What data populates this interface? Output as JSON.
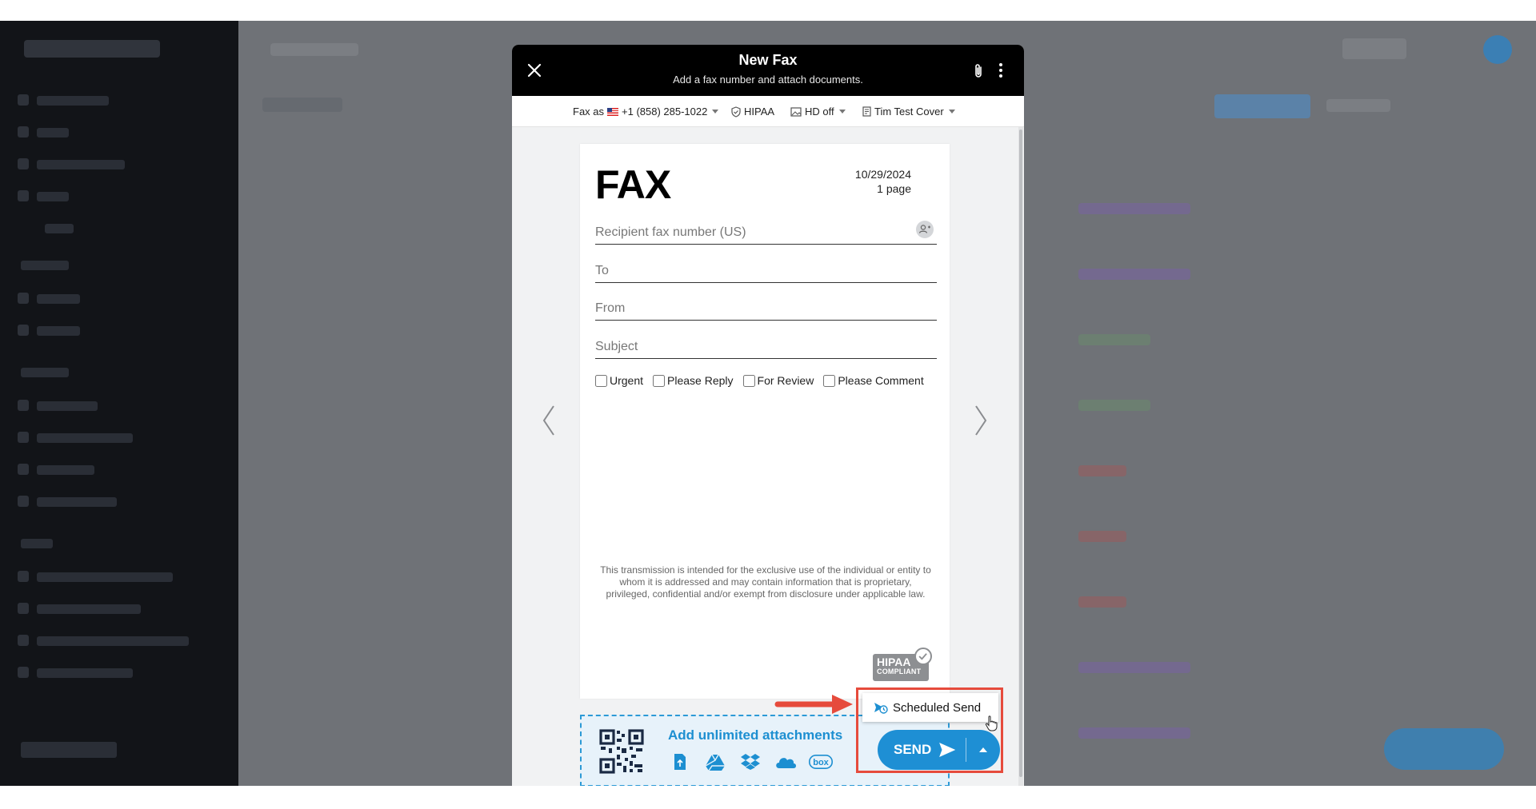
{
  "modal": {
    "title": "New Fax",
    "subtitle": "Add a fax number and attach documents."
  },
  "toolbar": {
    "fax_as_label": "Fax as",
    "fax_number": "+1 (858) 285-1022",
    "hipaa_label": "HIPAA",
    "hd_label": "HD off",
    "cover_label": "Tim Test Cover"
  },
  "cover": {
    "heading": "FAX",
    "date": "10/29/2024",
    "pages": "1 page",
    "fields": {
      "recipient_placeholder": "Recipient fax number (US)",
      "to_placeholder": "To",
      "from_placeholder": "From",
      "subject_placeholder": "Subject"
    },
    "checkboxes": {
      "urgent": "Urgent",
      "please_reply": "Please Reply",
      "for_review": "For Review",
      "please_comment": "Please Comment"
    },
    "disclaimer": "This transmission is intended for the exclusive use of the individual or entity to whom it is addressed and may contain information that is proprietary, privileged, confidential and/or exempt from disclosure under applicable law.",
    "hipaa_badge": {
      "main": "HIPAA",
      "sub": "COMPLIANT"
    }
  },
  "attachments": {
    "label": "Add unlimited attachments",
    "sources": [
      "upload-file",
      "google-drive",
      "dropbox",
      "onedrive",
      "box"
    ],
    "box_text": "box"
  },
  "send": {
    "label": "SEND",
    "scheduled_send": "Scheduled Send"
  },
  "colors": {
    "accent": "#1e8fd4",
    "header_bg": "#000000",
    "highlight": "#e64b3c"
  }
}
